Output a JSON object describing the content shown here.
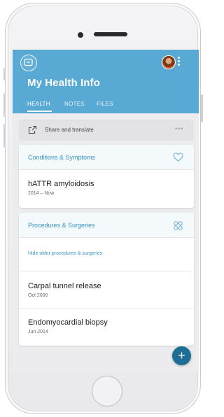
{
  "header": {
    "title": "My Health Info",
    "tabs": [
      {
        "label": "HEALTH",
        "active": true
      },
      {
        "label": "NOTES",
        "active": false
      },
      {
        "label": "FILES",
        "active": false
      }
    ],
    "logo_icon": "chat-heart-icon",
    "menu_icon": "kebab-menu-icon"
  },
  "share": {
    "label": "Share and translate",
    "more": "•••",
    "icon": "share-arrow-icon"
  },
  "conditions": {
    "title": "Conditions & Symptoms",
    "icon": "heart-icon",
    "items": [
      {
        "name": "hATTR amyloidosis",
        "date": "2014 – Now"
      }
    ]
  },
  "procedures": {
    "title": "Procedures & Surgeries",
    "icon": "bandage-icon",
    "hide_link": "Hide older procedures & surgeries",
    "items": [
      {
        "name": "Carpal tunnel release",
        "date": "Oct 2000"
      },
      {
        "name": "Endomyocardial biopsy",
        "date": "Jun 2014"
      }
    ]
  },
  "fab": {
    "label": "+"
  },
  "colors": {
    "header": "#58a9d3",
    "accent": "#3a93c2",
    "fab": "#1c6e95"
  }
}
